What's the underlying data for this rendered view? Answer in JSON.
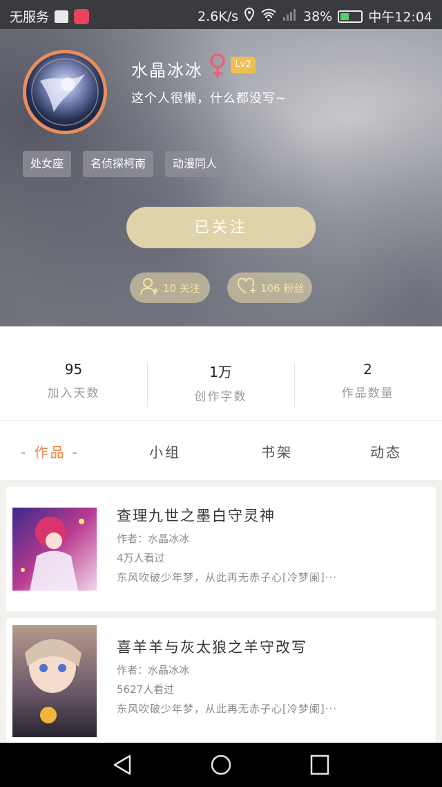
{
  "status_bar": {
    "carrier": "无服务",
    "speed": "2.6K/s",
    "battery_percent": "38%",
    "time": "中午12:04"
  },
  "profile": {
    "username": "水晶冰冰",
    "gender_icon": "female-icon",
    "level": "Lv2",
    "bio": "这个人很懒，什么都没写~",
    "tags": [
      "处女座",
      "名侦探柯南",
      "动漫同人"
    ],
    "follow_button": "已关注",
    "following": "10 关注",
    "fans": "106 粉丝"
  },
  "stats": [
    {
      "value": "95",
      "label": "加入天数"
    },
    {
      "value": "1万",
      "label": "创作字数"
    },
    {
      "value": "2",
      "label": "作品数量"
    }
  ],
  "tabs": [
    {
      "label": "- 作品 -",
      "active": true
    },
    {
      "label": "小组",
      "active": false
    },
    {
      "label": "书架",
      "active": false
    },
    {
      "label": "动态",
      "active": false
    }
  ],
  "works": [
    {
      "title": "查理九世之墨白守灵神",
      "author": "作者：水晶冰冰",
      "views": "4万人看过",
      "desc": "东风吹破少年梦，从此再无赤子心[冷梦阑]···"
    },
    {
      "title": "喜羊羊与灰太狼之羊守改写",
      "author": "作者：水晶冰冰",
      "views": "5627人看过",
      "desc": "东风吹破少年梦，从此再无赤子心[冷梦阑]···"
    }
  ],
  "colors": {
    "accent": "#f0874a",
    "level_badge": "#f2bf4a",
    "follow_button": "#dfd3a9",
    "gender": "#e8607a"
  }
}
